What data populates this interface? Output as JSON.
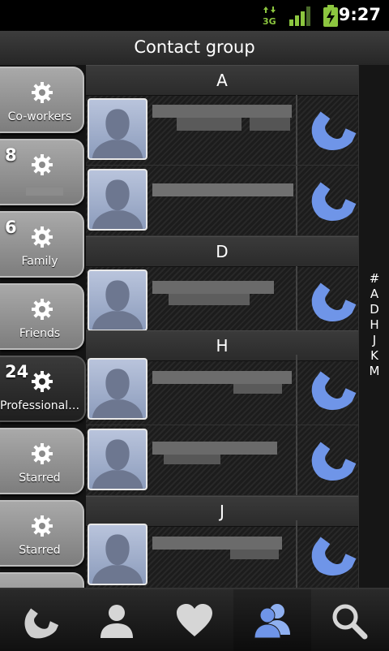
{
  "status_bar": {
    "time": "9:27",
    "network": "3G"
  },
  "title": "Contact group",
  "groups": [
    {
      "name": "Co-workers",
      "count": ""
    },
    {
      "name": "",
      "count": "8"
    },
    {
      "name": "Family",
      "count": "6"
    },
    {
      "name": "Friends",
      "count": ""
    },
    {
      "name": "Professional ...",
      "count": "24"
    },
    {
      "name": "Starred",
      "count": ""
    },
    {
      "name": "Starred",
      "count": ""
    }
  ],
  "sections": [
    "A",
    "D",
    "H",
    "J"
  ],
  "index_letters": [
    "#",
    "A",
    "D",
    "H",
    "J",
    "K",
    "M"
  ],
  "bottom_nav": [
    "phone",
    "contacts",
    "favorites",
    "groups",
    "search"
  ]
}
